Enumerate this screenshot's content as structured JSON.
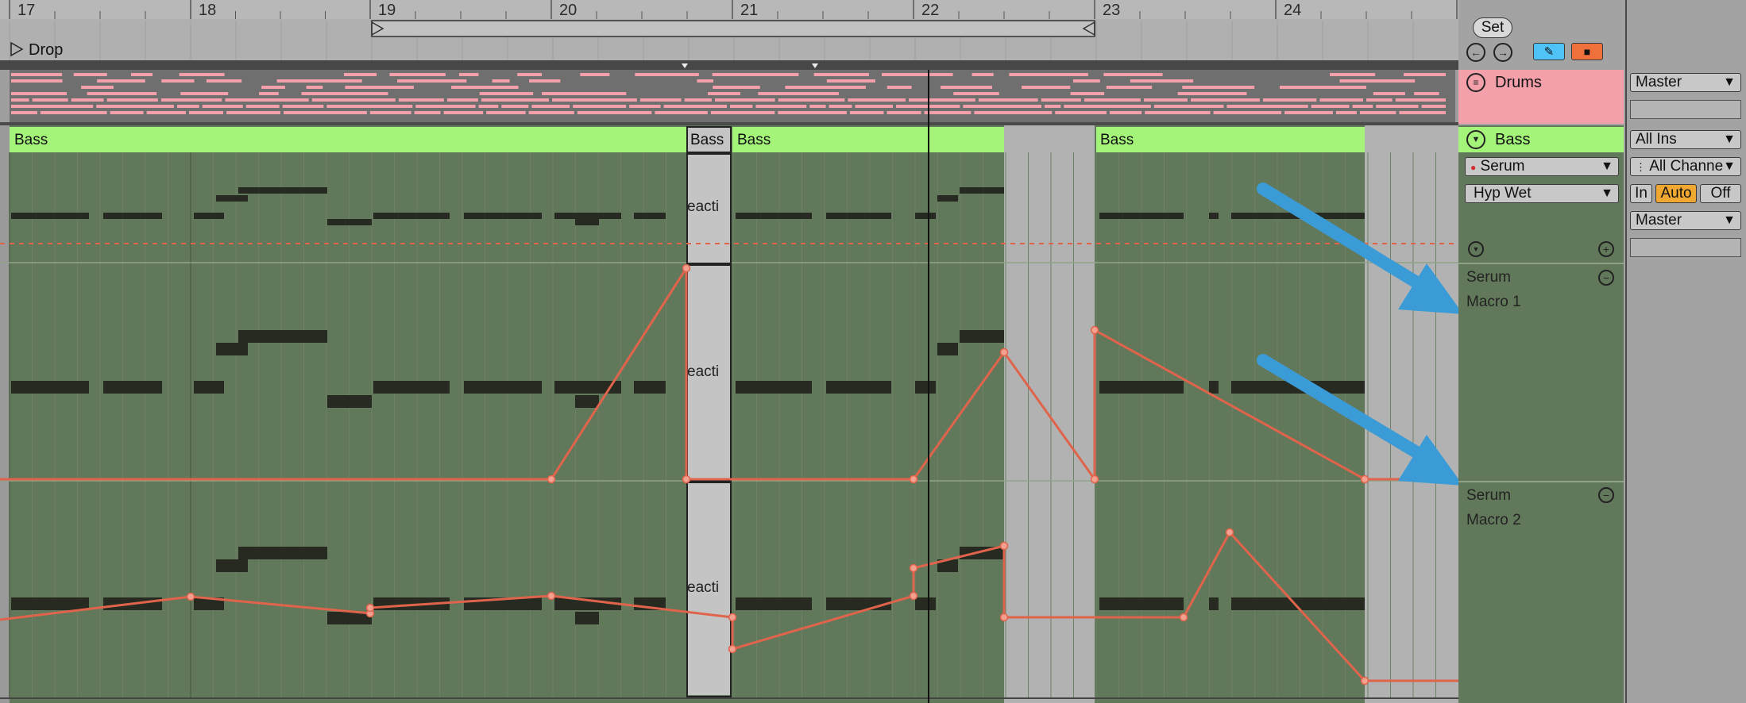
{
  "ruler": {
    "bars": [
      "17",
      "18",
      "19",
      "20",
      "21",
      "22",
      "23",
      "24"
    ],
    "loop_label": "Drop"
  },
  "clips": {
    "drums_name": "Drums",
    "bass_clip_names": [
      "Bass",
      "Bass",
      "Bass",
      "Bass"
    ],
    "deactivated_text": "eacti"
  },
  "session": {
    "set_button": "Set",
    "back_icon": "arrow-left-icon",
    "forward_icon": "arrow-right-icon",
    "draw_icon": "pencil-icon",
    "lock_icon": "lock-icon"
  },
  "tracks": {
    "drums": {
      "name": "Drums",
      "color": "#f3a0ab"
    },
    "bass": {
      "name": "Bass",
      "color": "#a4f47a",
      "device": "Serum",
      "parameter": "Hyp Wet",
      "lanes": [
        {
          "device": "Serum",
          "parameter": "Macro 1"
        },
        {
          "device": "Serum",
          "parameter": "Macro 2"
        }
      ]
    }
  },
  "io": {
    "drums_output": "Master",
    "bass_input_type": "All Ins",
    "bass_input_channel": "All Channels",
    "monitor_in": "In",
    "monitor_auto": "Auto",
    "monitor_off": "Off",
    "bass_output": "Master"
  },
  "colors": {
    "arrangement_bg": "#62785a",
    "automation": "#e0644c",
    "annotation_arrow": "#3b9bd6",
    "auto_active": "#f0a830",
    "lock_orange": "#f0703c",
    "draw_blue": "#4fc3f7"
  }
}
